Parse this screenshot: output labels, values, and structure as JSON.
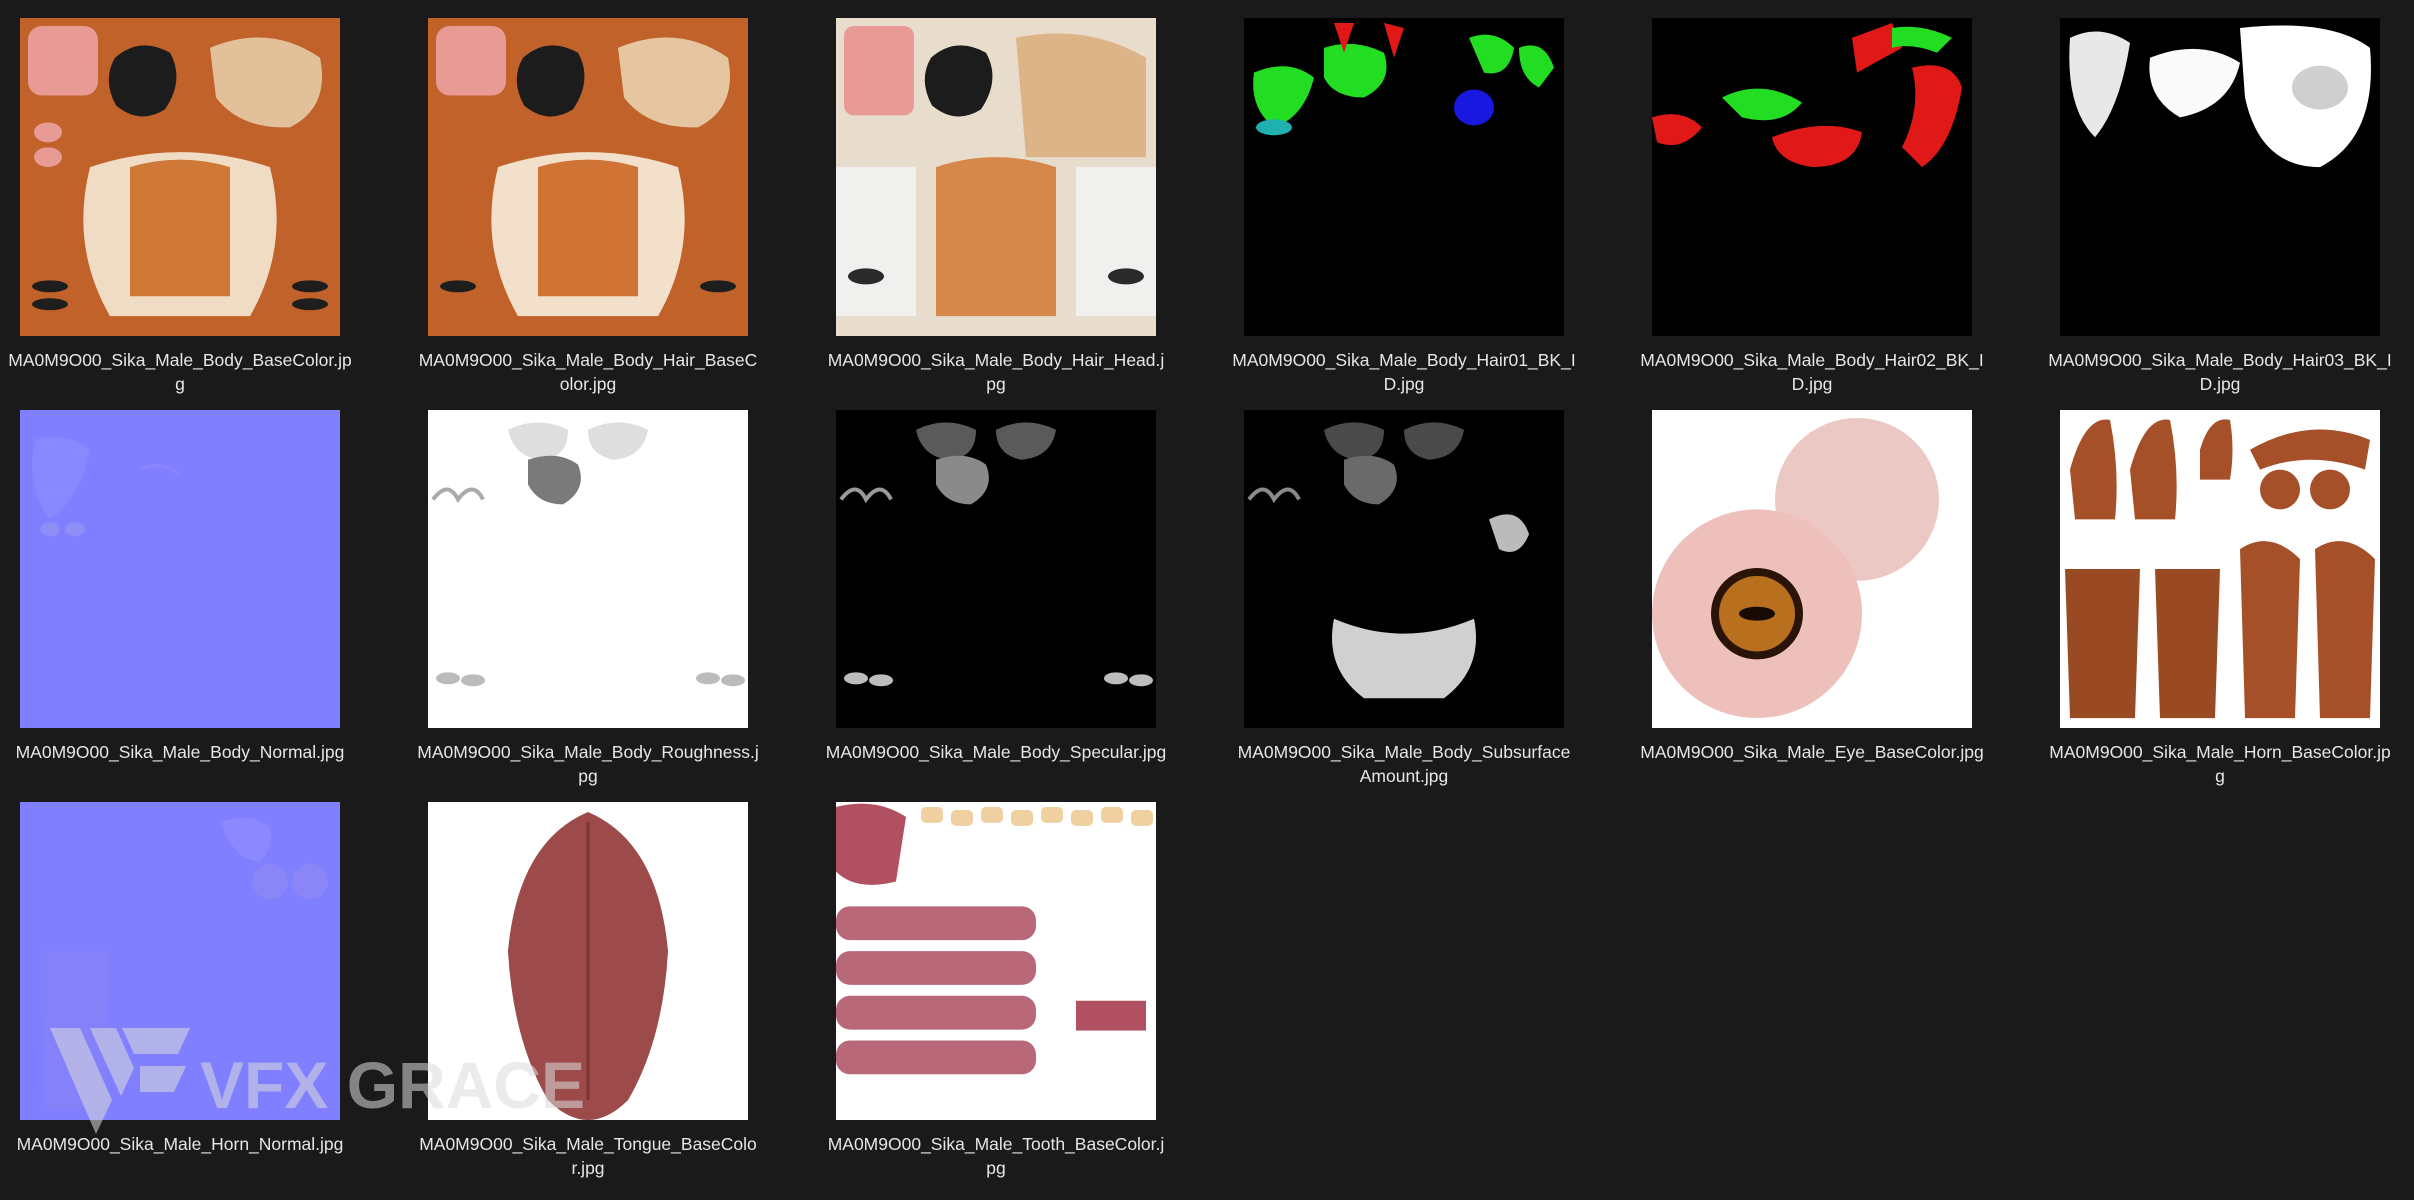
{
  "files": [
    {
      "name": "MA0M9O00_Sika_Male_Body_BaseColor.jpg",
      "preview": "basecolor"
    },
    {
      "name": "MA0M9O00_Sika_Male_Body_Hair_BaseColor.jpg",
      "preview": "haircolor"
    },
    {
      "name": "MA0M9O00_Sika_Male_Body_Hair_Head.jpg",
      "preview": "hairhead"
    },
    {
      "name": "MA0M9O00_Sika_Male_Body_Hair01_BK_ID.jpg",
      "preview": "id1"
    },
    {
      "name": "MA0M9O00_Sika_Male_Body_Hair02_BK_ID.jpg",
      "preview": "id2"
    },
    {
      "name": "MA0M9O00_Sika_Male_Body_Hair03_BK_ID.jpg",
      "preview": "id3"
    },
    {
      "name": "MA0M9O00_Sika_Male_Body_Normal.jpg",
      "preview": "normal"
    },
    {
      "name": "MA0M9O00_Sika_Male_Body_Roughness.jpg",
      "preview": "roughness"
    },
    {
      "name": "MA0M9O00_Sika_Male_Body_Specular.jpg",
      "preview": "specular"
    },
    {
      "name": "MA0M9O00_Sika_Male_Body_SubsurfaceAmount.jpg",
      "preview": "subsurface"
    },
    {
      "name": "MA0M9O00_Sika_Male_Eye_BaseColor.jpg",
      "preview": "eye"
    },
    {
      "name": "MA0M9O00_Sika_Male_Horn_BaseColor.jpg",
      "preview": "horn"
    },
    {
      "name": "MA0M9O00_Sika_Male_Horn_Normal.jpg",
      "preview": "hornnormal"
    },
    {
      "name": "MA0M9O00_Sika_Male_Tongue_BaseColor.jpg",
      "preview": "tongue"
    },
    {
      "name": "MA0M9O00_Sika_Male_Tooth_BaseColor.jpg",
      "preview": "tooth"
    }
  ],
  "watermark": {
    "text": "VFX GRACE"
  },
  "colors": {
    "background": "#1a1a1a",
    "label": "#e6e6e6",
    "normal_blue": "#7f7fff",
    "fur_orange": "#c0622a",
    "horn_brown": "#a6502a",
    "id_green": "#22dd22",
    "id_red": "#e01818",
    "id_blue": "#1818e0"
  }
}
